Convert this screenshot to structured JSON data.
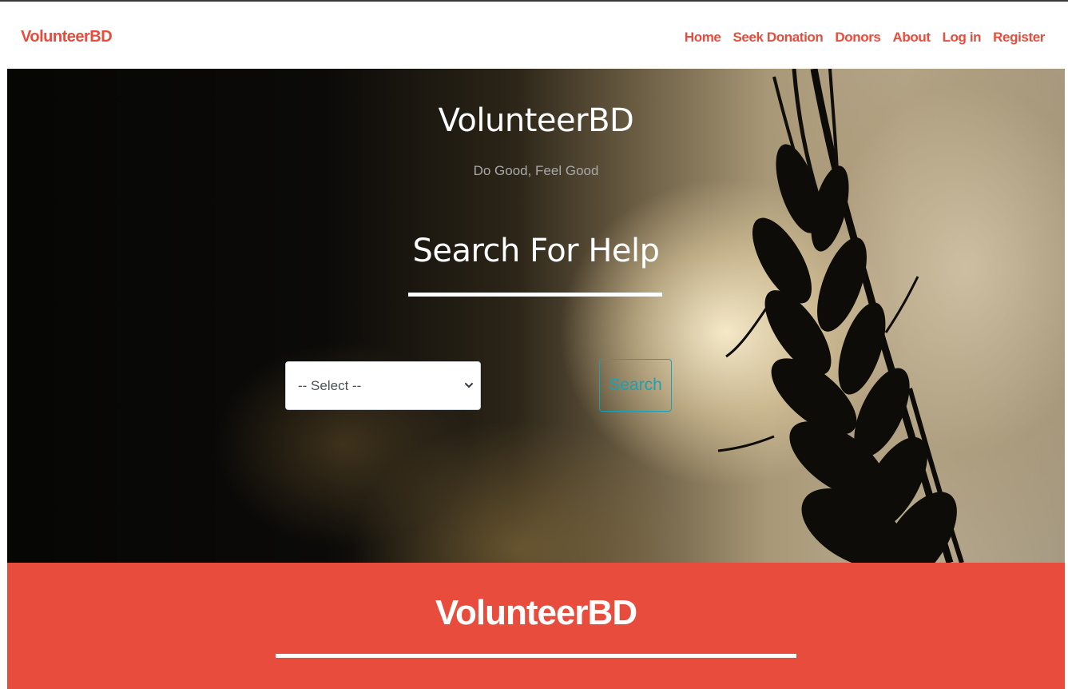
{
  "navbar": {
    "brand": "VolunteerBD",
    "links": [
      "Home",
      "Seek Donation",
      "Donors",
      "About",
      "Log in",
      "Register"
    ]
  },
  "hero": {
    "title": "VolunteerBD",
    "tagline": "Do Good, Feel Good",
    "search_heading": "Search For Help",
    "select": {
      "selected": "-- Select --"
    },
    "search_button_label": "Search"
  },
  "footer_section": {
    "title": "VolunteerBD"
  },
  "colors": {
    "accent": "#e74c3c",
    "button_outline": "#17a2b8"
  },
  "icons": {
    "select_chevron": "chevron-down-icon"
  }
}
